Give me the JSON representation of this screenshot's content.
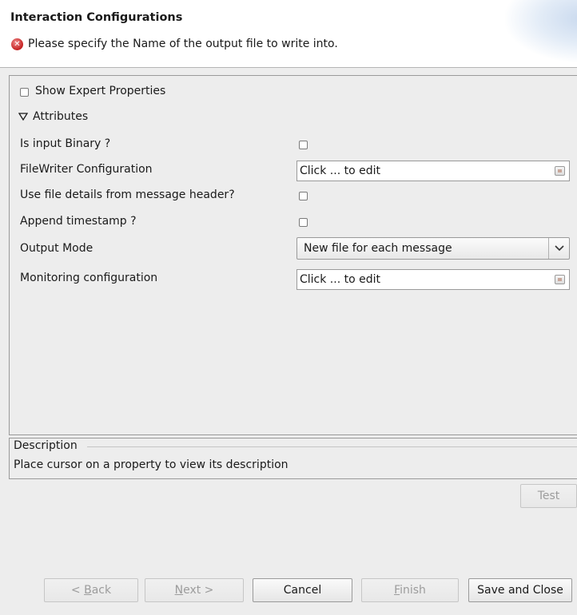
{
  "header": {
    "title": "Interaction Configurations",
    "message": "Please specify the Name of the output file to write into.",
    "message_icon": "error-icon",
    "error_color": "#c42020"
  },
  "panel": {
    "show_expert_label": "Show Expert Properties",
    "show_expert_checked": false,
    "attributes_label": "Attributes",
    "attributes_expanded": true,
    "properties": [
      {
        "label": "Is input Binary ?",
        "control": "checkbox",
        "checked": false
      },
      {
        "label": "FileWriter Configuration",
        "control": "edit",
        "value": "Click ... to edit"
      },
      {
        "label": "Use file details from message header?",
        "control": "checkbox",
        "checked": false
      },
      {
        "label": "Append timestamp ?",
        "control": "checkbox",
        "checked": false
      },
      {
        "label": "Output Mode",
        "control": "select",
        "value": "New file for each message"
      },
      {
        "label": "Monitoring configuration",
        "control": "edit",
        "value": "Click ... to edit"
      }
    ]
  },
  "description": {
    "title": "Description",
    "text": "Place cursor on a property to view its description"
  },
  "buttons": {
    "test": "Test",
    "back_mnemonic": "B",
    "back_rest": "ack",
    "back_prefix": "< ",
    "next_mnemonic": "N",
    "next_rest": "ext >",
    "cancel": "Cancel",
    "finish_mnemonic": "F",
    "finish_rest": "inish",
    "save_close": "Save and Close"
  }
}
